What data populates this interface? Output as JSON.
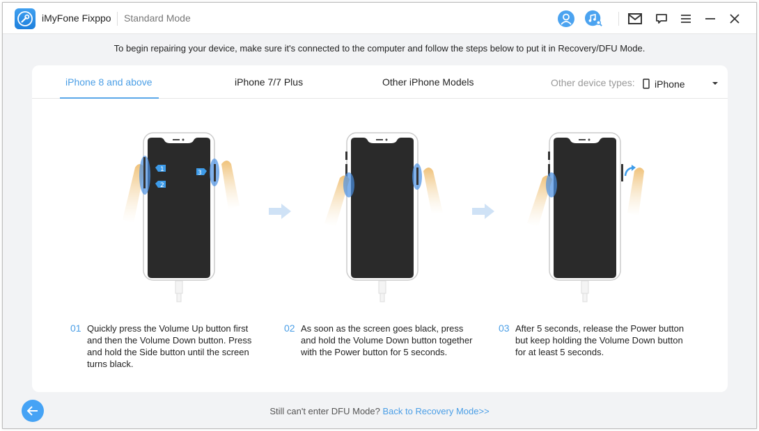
{
  "titlebar": {
    "app_name": "iMyFone Fixppo",
    "mode": "Standard Mode",
    "icons": [
      "account-icon",
      "music-search-icon",
      "mail-icon",
      "feedback-icon",
      "menu-icon",
      "minimize-icon",
      "close-icon"
    ]
  },
  "instruction": "To begin repairing your device, make sure it's connected to the computer and follow the steps below to put it in Recovery/DFU Mode.",
  "tabs": [
    {
      "label": "iPhone 8 and above",
      "active": true
    },
    {
      "label": "iPhone 7/7 Plus",
      "active": false
    },
    {
      "label": "Other iPhone Models",
      "active": false
    }
  ],
  "device": {
    "label": "Other device types:",
    "selected": "iPhone"
  },
  "steps": [
    {
      "num": "01",
      "text": "Quickly press the Volume Up button first and then the Volume Down button. Press and hold the Side button until the screen turns black.",
      "badges": [
        "1",
        "2",
        "3"
      ]
    },
    {
      "num": "02",
      "text": "As soon as the screen goes black, press and hold the Volume Down button together with the Power button for 5 seconds."
    },
    {
      "num": "03",
      "text": "After 5 seconds, release the Power button but keep holding the Volume Down button for at least 5 seconds."
    }
  ],
  "footer": {
    "question": "Still can't enter DFU Mode?",
    "link": "Back to Recovery Mode>>"
  },
  "colors": {
    "accent": "#4a9ee6",
    "back_button": "#46a3f5",
    "phone_screen": "#2a2a2a"
  }
}
